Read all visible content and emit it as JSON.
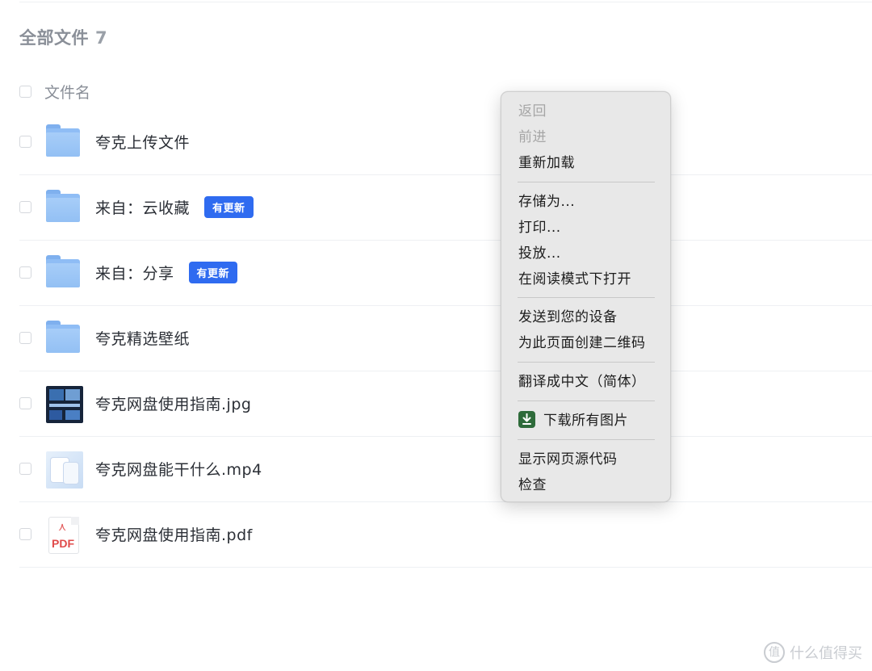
{
  "header": {
    "title": "全部文件",
    "count": "7"
  },
  "list_header": {
    "name_label": "文件名"
  },
  "files": [
    {
      "name": "夸克上传文件",
      "type": "folder",
      "badge": ""
    },
    {
      "name": "来自：云收藏",
      "type": "folder",
      "badge": "有更新"
    },
    {
      "name": "来自：分享",
      "type": "folder",
      "badge": "有更新"
    },
    {
      "name": "夸克精选壁纸",
      "type": "folder",
      "badge": ""
    },
    {
      "name": "夸克网盘使用指南.jpg",
      "type": "image",
      "badge": ""
    },
    {
      "name": "夸克网盘能干什么.mp4",
      "type": "video",
      "badge": ""
    },
    {
      "name": "夸克网盘使用指南.pdf",
      "type": "pdf",
      "badge": ""
    }
  ],
  "pdf_icon_label": "PDF",
  "context_menu": {
    "back": "返回",
    "forward": "前进",
    "reload": "重新加载",
    "save_as": "存储为...",
    "print": "打印...",
    "cast": "投放...",
    "reader_mode": "在阅读模式下打开",
    "send_to_devices": "发送到您的设备",
    "create_qr": "为此页面创建二维码",
    "translate": "翻译成中文（简体）",
    "download_images": "下载所有图片",
    "view_source": "显示网页源代码",
    "inspect": "检查"
  },
  "watermark": {
    "logo": "值",
    "text": "什么值得买"
  },
  "colors": {
    "badge": "#2f6bf0",
    "menu_bg": "#e8e8e8",
    "folder": "#8fbdf5"
  }
}
